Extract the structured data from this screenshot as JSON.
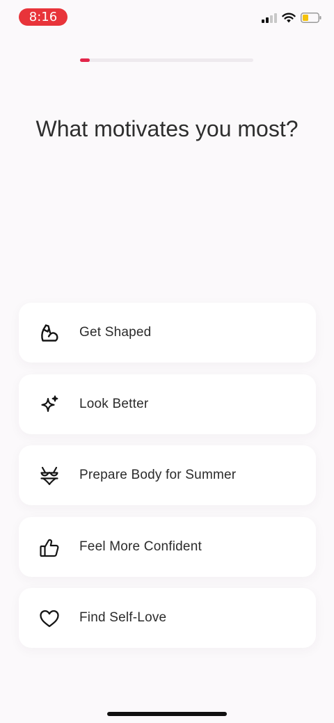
{
  "status_bar": {
    "time": "8:16",
    "icons": [
      "cellular-signal-icon",
      "wifi-icon",
      "battery-low-icon"
    ],
    "accent": "#e8343a"
  },
  "progress": {
    "fraction": 0.055,
    "fill_color": "#e2264a"
  },
  "question": {
    "title": "What motivates you most?"
  },
  "options": [
    {
      "label": "Get Shaped",
      "icon": "flexed-arm-icon"
    },
    {
      "label": "Look Better",
      "icon": "sparkle-icon"
    },
    {
      "label": "Prepare Body for Summer",
      "icon": "bikini-icon"
    },
    {
      "label": "Feel More Confident",
      "icon": "thumbs-up-icon"
    },
    {
      "label": "Find Self-Love",
      "icon": "heart-icon"
    }
  ]
}
